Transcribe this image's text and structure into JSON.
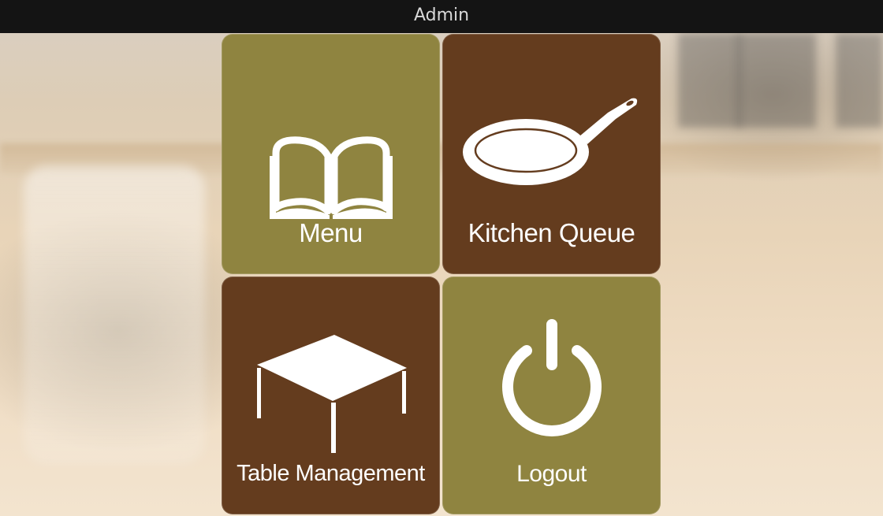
{
  "window": {
    "title": "Admin"
  },
  "colors": {
    "olive": "#8f8440",
    "brown": "#643c1e",
    "titlebar": "#141414",
    "icon": "#ffffff"
  },
  "tiles": [
    {
      "label": "Menu",
      "icon": "book-icon",
      "color": "olive"
    },
    {
      "label": "Kitchen Queue",
      "icon": "frying-pan-icon",
      "color": "brown"
    },
    {
      "label": "Table Management",
      "icon": "table-icon",
      "color": "brown"
    },
    {
      "label": "Logout",
      "icon": "power-icon",
      "color": "olive"
    }
  ]
}
